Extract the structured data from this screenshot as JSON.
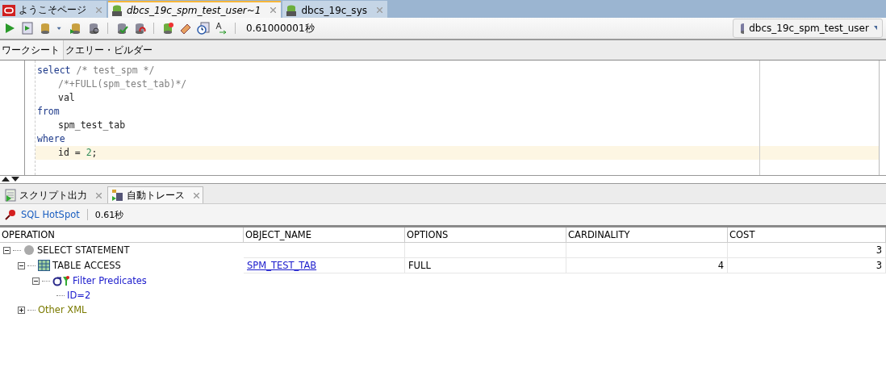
{
  "doc_tabs": [
    {
      "label": "ようこそページ",
      "kind": "welcome",
      "selected": false
    },
    {
      "label": "dbcs_19c_spm_test_user~1",
      "kind": "sql",
      "selected": true
    },
    {
      "label": "dbcs_19c_sys",
      "kind": "sql",
      "selected": false
    }
  ],
  "toolbar": {
    "elapsed": "0.61000001秒",
    "connection": "dbcs_19c_spm_test_user"
  },
  "editor_tabs": [
    {
      "label": "ワークシート",
      "selected": true
    },
    {
      "label": "クエリー・ビルダー",
      "selected": false
    }
  ],
  "code_lines": [
    {
      "indent": false,
      "current": false,
      "tokens": [
        {
          "kind": "keyword",
          "text": "select"
        },
        {
          "kind": "comment",
          "text": " /* test_spm */"
        }
      ]
    },
    {
      "indent": true,
      "current": false,
      "tokens": [
        {
          "kind": "comment",
          "text": "/*+FULL(spm_test_tab)*/"
        }
      ]
    },
    {
      "indent": true,
      "current": false,
      "tokens": [
        {
          "kind": "plain",
          "text": "val"
        }
      ]
    },
    {
      "indent": false,
      "current": false,
      "tokens": [
        {
          "kind": "keyword",
          "text": "from"
        }
      ]
    },
    {
      "indent": true,
      "current": false,
      "tokens": [
        {
          "kind": "plain",
          "text": "spm_test_tab"
        }
      ]
    },
    {
      "indent": false,
      "current": false,
      "tokens": [
        {
          "kind": "keyword",
          "text": "where"
        }
      ]
    },
    {
      "indent": true,
      "current": true,
      "tokens": [
        {
          "kind": "plain",
          "text": "id = "
        },
        {
          "kind": "number",
          "text": "2"
        },
        {
          "kind": "plain",
          "text": ";"
        }
      ]
    }
  ],
  "output_tabs": [
    {
      "label": "スクリプト出力",
      "kind": "script",
      "selected": false
    },
    {
      "label": "自動トレース",
      "kind": "trace",
      "selected": true
    }
  ],
  "trace_toolbar": {
    "link": "SQL  HotSpot",
    "elapsed": "0.61秒"
  },
  "table": {
    "columns": [
      "OPERATION",
      "OBJECT_NAME",
      "OPTIONS",
      "CARDINALITY",
      "COST"
    ],
    "rows": [
      {
        "kind": "statement",
        "operation": "SELECT STATEMENT",
        "expanded": true,
        "object_name": "",
        "options": "",
        "cardinality": "",
        "cost": "3",
        "children": [
          {
            "kind": "table",
            "operation": "TABLE ACCESS",
            "expanded": true,
            "object_name": "SPM_TEST_TAB",
            "options": "FULL",
            "cardinality": "4",
            "cost": "3",
            "children": [
              {
                "kind": "filter",
                "operation": "Filter Predicates",
                "expanded": true,
                "children": [
                  {
                    "kind": "predicate",
                    "operation": "ID=2"
                  }
                ]
              }
            ]
          },
          {
            "kind": "xml",
            "operation": "Other XML",
            "expanded": false
          }
        ]
      }
    ]
  }
}
